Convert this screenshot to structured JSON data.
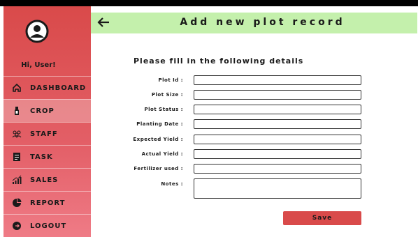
{
  "sidebar": {
    "greeting": "Hi, User!",
    "items": [
      {
        "label": "DASHBOARD",
        "icon": "home-icon"
      },
      {
        "label": "CROP",
        "icon": "crop-icon",
        "active": true
      },
      {
        "label": "STAFF",
        "icon": "staff-icon"
      },
      {
        "label": "TASK",
        "icon": "task-icon"
      },
      {
        "label": "SALES",
        "icon": "sales-icon"
      },
      {
        "label": "REPORT",
        "icon": "report-icon"
      },
      {
        "label": "LOGOUT",
        "icon": "logout-icon"
      }
    ]
  },
  "header": {
    "title": "Add new plot record"
  },
  "form": {
    "heading": "Please fill in the following details",
    "fields": [
      {
        "label": "Plot Id :",
        "value": ""
      },
      {
        "label": "Plot Size :",
        "value": ""
      },
      {
        "label": "Plot Status :",
        "value": ""
      },
      {
        "label": "Planting Date :",
        "value": ""
      },
      {
        "label": "Expected Yield :",
        "value": ""
      },
      {
        "label": "Actual Yield :",
        "value": ""
      },
      {
        "label": "Fertilizer used :",
        "value": ""
      },
      {
        "label": "Notes :",
        "value": ""
      }
    ],
    "save_label": "Save"
  },
  "colors": {
    "sidebar_top": "#d94a4a",
    "sidebar_bottom": "#ef7b86",
    "header_bg": "#c4f0ac",
    "save_button": "#d94a4a"
  }
}
